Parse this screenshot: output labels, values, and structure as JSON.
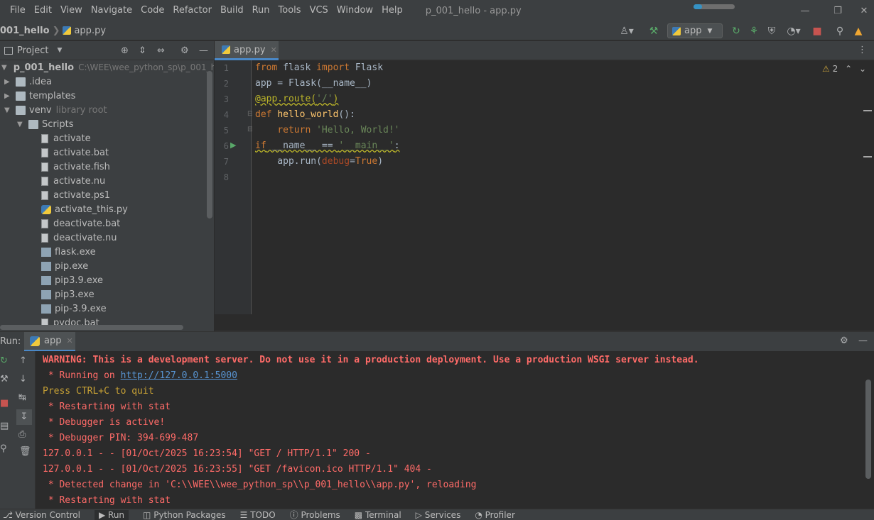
{
  "menu": [
    "File",
    "Edit",
    "View",
    "Navigate",
    "Code",
    "Refactor",
    "Build",
    "Run",
    "Tools",
    "VCS",
    "Window",
    "Help"
  ],
  "window_title": "p_001_hello - app.py",
  "background_progress": 0.2,
  "breadcrumb": [
    "001_hello",
    "app.py"
  ],
  "run_config_label": "app",
  "project_panel": {
    "title": "Project",
    "root": {
      "label": "p_001_hello",
      "path": "C:\\WEE\\wee_python_sp\\p_001_he"
    },
    "items": [
      {
        "label": ".idea",
        "type": "folder",
        "depth": 1,
        "expanded": false
      },
      {
        "label": "templates",
        "type": "folder",
        "depth": 1,
        "expanded": false
      },
      {
        "label": "venv",
        "type": "folder",
        "depth": 1,
        "expanded": true,
        "hint": "library root"
      },
      {
        "label": "Scripts",
        "type": "folder",
        "depth": 2,
        "expanded": true
      },
      {
        "label": "activate",
        "type": "file",
        "depth": 3
      },
      {
        "label": "activate.bat",
        "type": "file",
        "depth": 3
      },
      {
        "label": "activate.fish",
        "type": "file",
        "depth": 3
      },
      {
        "label": "activate.nu",
        "type": "file",
        "depth": 3
      },
      {
        "label": "activate.ps1",
        "type": "file",
        "depth": 3
      },
      {
        "label": "activate_this.py",
        "type": "py",
        "depth": 3
      },
      {
        "label": "deactivate.bat",
        "type": "file",
        "depth": 3
      },
      {
        "label": "deactivate.nu",
        "type": "file",
        "depth": 3
      },
      {
        "label": "flask.exe",
        "type": "exe",
        "depth": 3
      },
      {
        "label": "pip.exe",
        "type": "exe",
        "depth": 3
      },
      {
        "label": "pip3.9.exe",
        "type": "exe",
        "depth": 3
      },
      {
        "label": "pip3.exe",
        "type": "exe",
        "depth": 3
      },
      {
        "label": "pip-3.9.exe",
        "type": "exe",
        "depth": 3
      },
      {
        "label": "pydoc.bat",
        "type": "file",
        "depth": 3
      }
    ]
  },
  "editor": {
    "tab_label": "app.py",
    "warning_count": "2",
    "line_numbers": [
      "1",
      "2",
      "3",
      "4",
      "5",
      "6",
      "7",
      "8"
    ]
  },
  "run_panel": {
    "label": "Run:",
    "tab_label": "app",
    "console": [
      {
        "text": "WARNING: This is a development server. Do not use it in a production deployment. Use a production WSGI server instead.",
        "style": "red-bold"
      },
      {
        "prefix": " * Running on ",
        "link": "http://127.0.0.1:5000",
        "style": "red"
      },
      {
        "text": "Press CTRL+C to quit",
        "style": "yellow"
      },
      {
        "text": " * Restarting with stat",
        "style": "red"
      },
      {
        "text": " * Debugger is active!",
        "style": "red"
      },
      {
        "text": " * Debugger PIN: 394-699-487",
        "style": "red"
      },
      {
        "text": "127.0.0.1 - - [01/Oct/2025 16:23:54] \"GET / HTTP/1.1\" 200 -",
        "style": "red"
      },
      {
        "text": "127.0.0.1 - - [01/Oct/2025 16:23:55] \"GET /favicon.ico HTTP/1.1\" 404 -",
        "style": "red"
      },
      {
        "text": " * Detected change in 'C:\\\\WEE\\\\wee_python_sp\\\\p_001_hello\\\\app.py', reloading",
        "style": "red"
      },
      {
        "text": " * Restarting with stat",
        "style": "red"
      }
    ]
  },
  "bottom_tools": [
    "Version Control",
    "Run",
    "Python Packages",
    "TODO",
    "Problems",
    "Terminal",
    "Services",
    "Profiler"
  ],
  "colors": {
    "accent": "#4a88c7",
    "console_red": "#ff6b68",
    "console_yellow": "#c6a035",
    "run_green": "#59a869"
  }
}
